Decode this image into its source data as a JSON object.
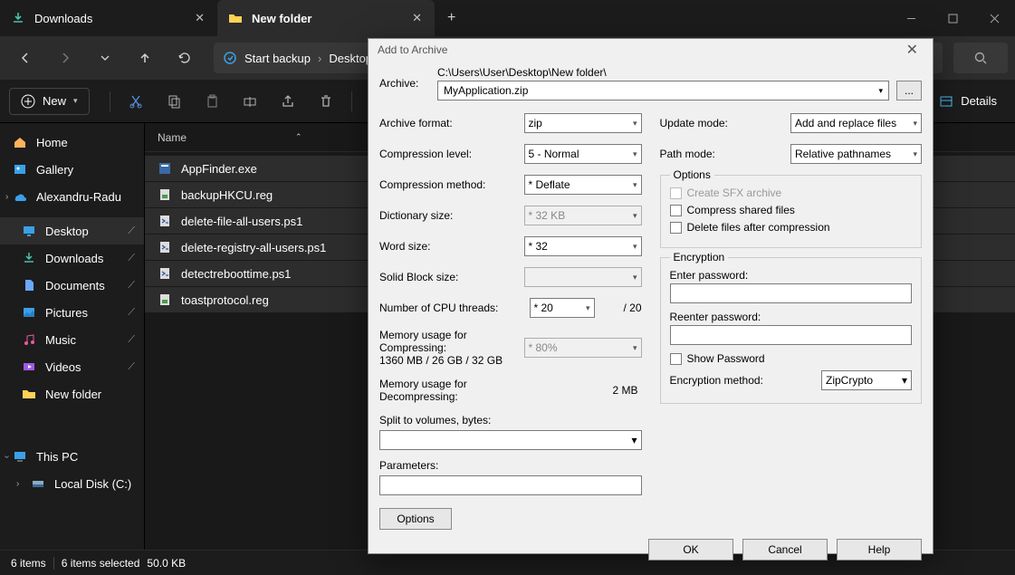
{
  "tabs": [
    {
      "label": "Downloads",
      "icon": "download-icon",
      "active": false
    },
    {
      "label": "New folder",
      "icon": "folder-icon",
      "active": true
    }
  ],
  "breadcrumb": {
    "start": "Start backup",
    "items": [
      "Desktop"
    ]
  },
  "new_button": "New",
  "details_button": "Details",
  "sidebar": {
    "home": "Home",
    "gallery": "Gallery",
    "user": "Alexandru-Radu",
    "quick": [
      {
        "label": "Desktop",
        "icon": "desktop-icon",
        "selected": true
      },
      {
        "label": "Downloads",
        "icon": "download-icon"
      },
      {
        "label": "Documents",
        "icon": "document-icon"
      },
      {
        "label": "Pictures",
        "icon": "pictures-icon"
      },
      {
        "label": "Music",
        "icon": "music-icon"
      },
      {
        "label": "Videos",
        "icon": "videos-icon"
      },
      {
        "label": "New folder",
        "icon": "folder-icon"
      }
    ],
    "thispc": "This PC",
    "localdisk": "Local Disk (C:)"
  },
  "columns": {
    "name": "Name"
  },
  "files": [
    {
      "name": "AppFinder.exe",
      "icon": "exe-icon"
    },
    {
      "name": "backupHKCU.reg",
      "icon": "reg-icon"
    },
    {
      "name": "delete-file-all-users.ps1",
      "icon": "ps1-icon"
    },
    {
      "name": "delete-registry-all-users.ps1",
      "icon": "ps1-icon"
    },
    {
      "name": "detectreboottime.ps1",
      "icon": "ps1-icon"
    },
    {
      "name": "toastprotocol.reg",
      "icon": "reg-icon"
    }
  ],
  "status": {
    "count": "6 items",
    "selected": "6 items selected",
    "size": "50.0 KB"
  },
  "dialog": {
    "title": "Add to Archive",
    "archive_label": "Archive:",
    "path": "C:\\Users\\User\\Desktop\\New folder\\",
    "filename": "MyApplication.zip",
    "browse": "...",
    "left": {
      "format_label": "Archive format:",
      "format": "zip",
      "level_label": "Compression level:",
      "level": "5 - Normal",
      "method_label": "Compression method:",
      "method": "*  Deflate",
      "dict_label": "Dictionary size:",
      "dict": "*  32 KB",
      "word_label": "Word size:",
      "word": "*  32",
      "solid_label": "Solid Block size:",
      "solid": "",
      "threads_label": "Number of CPU threads:",
      "threads": "*  20",
      "threads_max": "/ 20",
      "mem_c_label": "Memory usage for Compressing:",
      "mem_c_detail": "1360 MB / 26 GB / 32 GB",
      "mem_c_val": "*  80%",
      "mem_d_label": "Memory usage for Decompressing:",
      "mem_d_val": "2 MB",
      "split_label": "Split to volumes, bytes:",
      "params_label": "Parameters:",
      "options_btn": "Options"
    },
    "right": {
      "update_label": "Update mode:",
      "update": "Add and replace files",
      "pathmode_label": "Path mode:",
      "pathmode": "Relative pathnames",
      "options_title": "Options",
      "opt_sfx": "Create SFX archive",
      "opt_shared": "Compress shared files",
      "opt_delete": "Delete files after compression",
      "enc_title": "Encryption",
      "enter_pass": "Enter password:",
      "reenter_pass": "Reenter password:",
      "show_pass": "Show Password",
      "enc_method_label": "Encryption method:",
      "enc_method": "ZipCrypto"
    },
    "buttons": {
      "ok": "OK",
      "cancel": "Cancel",
      "help": "Help"
    }
  }
}
